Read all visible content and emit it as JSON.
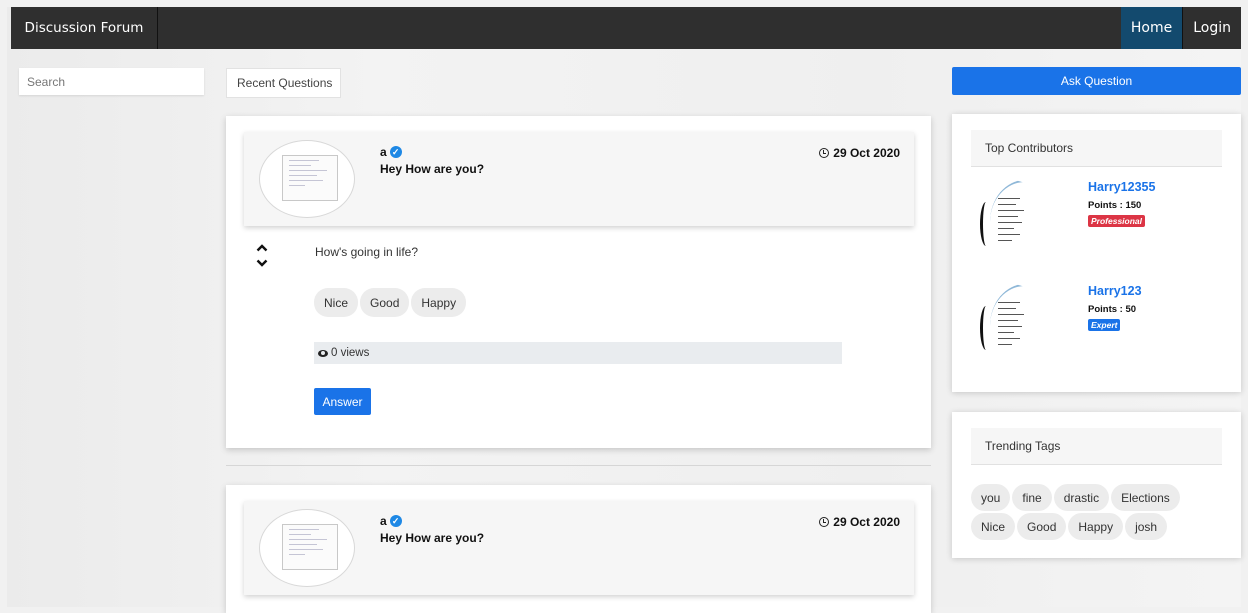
{
  "navbar": {
    "brand": "Discussion Forum",
    "links": [
      {
        "label": "Home",
        "active": true
      },
      {
        "label": "Login",
        "active": false
      }
    ]
  },
  "search": {
    "placeholder": "Search"
  },
  "main": {
    "tab_label": "Recent Questions",
    "questions": [
      {
        "author": "a",
        "title": "Hey How are you?",
        "date": "29 Oct 2020",
        "body": "How's going in life?",
        "tags": [
          "Nice",
          "Good",
          "Happy"
        ],
        "views": "0 views",
        "answer_label": "Answer"
      },
      {
        "author": "a",
        "title": "Hey How are you?",
        "date": "29 Oct 2020"
      }
    ]
  },
  "sidebar": {
    "ask_label": "Ask Question",
    "top_contributors": {
      "title": "Top Contributors",
      "items": [
        {
          "name": "Harry12355",
          "points": "Points : 150",
          "badge": "Professional",
          "badge_color": "#dc3545"
        },
        {
          "name": "Harry123",
          "points": "Points : 50",
          "badge": "Expert",
          "badge_color": "#1a73e8"
        }
      ]
    },
    "trending": {
      "title": "Trending Tags",
      "tags": [
        "you",
        "fine",
        "drastic",
        "Elections",
        "Nice",
        "Good",
        "Happy",
        "josh"
      ]
    }
  },
  "colors": {
    "navbar": "#2f2f2f",
    "nav_active": "#134a6e",
    "primary": "#1a73e8",
    "badge_professional": "#dc3545"
  }
}
